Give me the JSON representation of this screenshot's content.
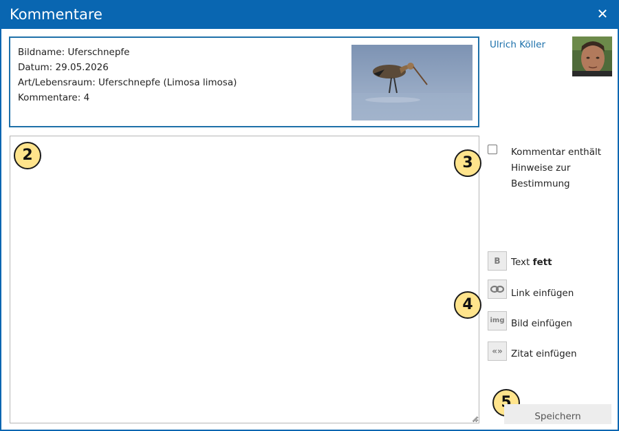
{
  "dialog": {
    "title": "Kommentare",
    "close_icon": "close-icon"
  },
  "info": {
    "image_name": "Bildname: Uferschnepfe",
    "date": "Datum: 29.05.2026",
    "species": "Art/Lebensraum: Uferschnepfe (Limosa limosa)",
    "comments": "Kommentare: 4"
  },
  "author": {
    "name": "Ulrich Köller"
  },
  "comment_field": {
    "value": "",
    "placeholder": ""
  },
  "hint_checkbox": {
    "label": "Kommentar enthält Hinweise zur Bestimmung",
    "checked": false
  },
  "toolbar": {
    "bold": {
      "icon_text": "B",
      "label_prefix": "Text ",
      "label_bold": "fett"
    },
    "link": {
      "icon": "link-icon",
      "label": "Link einfügen"
    },
    "image": {
      "icon_text": "img",
      "label": "Bild einfügen"
    },
    "quote": {
      "icon_text": "«»",
      "label": "Zitat einfügen"
    }
  },
  "save_label": "Speichern",
  "annotations": [
    "2",
    "3",
    "4",
    "5"
  ],
  "colors": {
    "accent": "#0966b1",
    "badge": "#ffe48c",
    "link": "#1a6faa"
  }
}
